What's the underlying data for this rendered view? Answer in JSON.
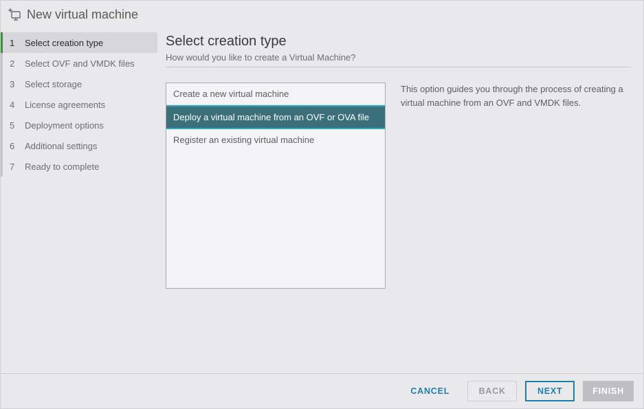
{
  "titlebar": {
    "title": "New virtual machine"
  },
  "sidebar": {
    "steps": [
      {
        "num": "1",
        "label": "Select creation type",
        "active": true
      },
      {
        "num": "2",
        "label": "Select OVF and VMDK files",
        "active": false
      },
      {
        "num": "3",
        "label": "Select storage",
        "active": false
      },
      {
        "num": "4",
        "label": "License agreements",
        "active": false
      },
      {
        "num": "5",
        "label": "Deployment options",
        "active": false
      },
      {
        "num": "6",
        "label": "Additional settings",
        "active": false
      },
      {
        "num": "7",
        "label": "Ready to complete",
        "active": false
      }
    ]
  },
  "main": {
    "heading": "Select creation type",
    "subtitle": "How would you like to create a Virtual Machine?",
    "options": [
      {
        "label": "Create a new virtual machine",
        "selected": false
      },
      {
        "label": "Deploy a virtual machine from an OVF or OVA file",
        "selected": true
      },
      {
        "label": "Register an existing virtual machine",
        "selected": false
      }
    ],
    "description": "This option guides you through the process of creating a virtual machine from an OVF and VMDK files."
  },
  "footer": {
    "cancel": "CANCEL",
    "back": "BACK",
    "next": "NEXT",
    "finish": "FINISH"
  }
}
